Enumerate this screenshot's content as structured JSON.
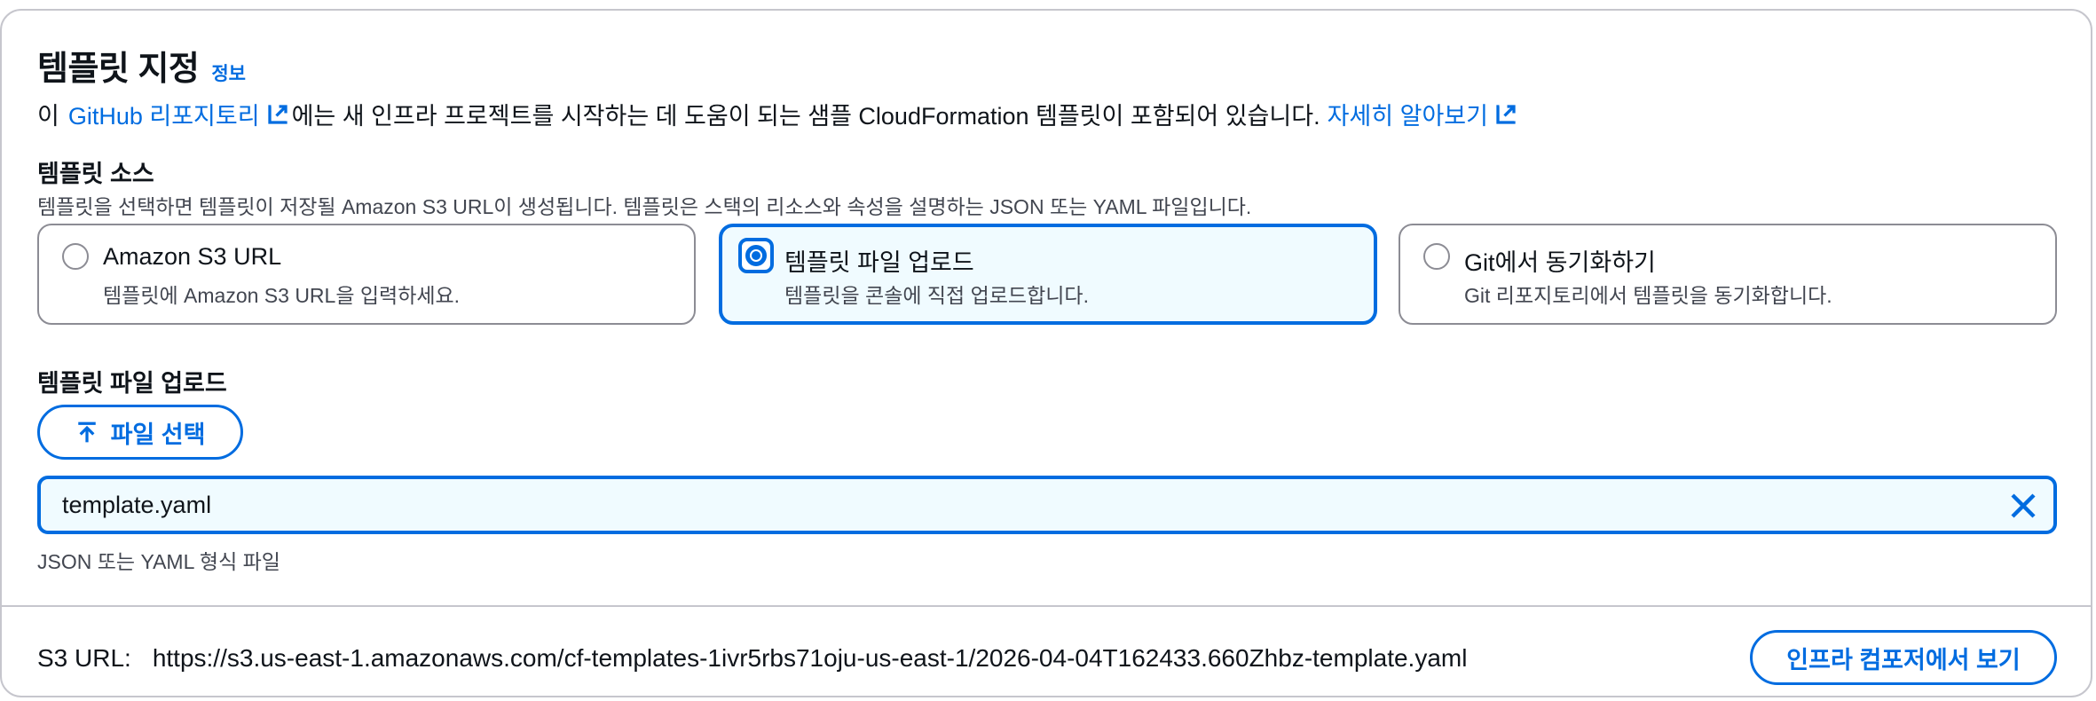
{
  "section": {
    "title": "템플릿 지정",
    "info_link": "정보",
    "description": {
      "prefix": "이",
      "repo_link": "GitHub 리포지토리",
      "middle": "에는 새 인프라 프로젝트를 시작하는 데 도움이 되는 샘플 CloudFormation 템플릿이 포함되어 있습니다.",
      "learn_more_link": "자세히 알아보기"
    }
  },
  "template_source": {
    "label": "템플릿 소스",
    "hint": "템플릿을 선택하면 템플릿이 저장될 Amazon S3 URL이 생성됩니다. 템플릿은 스택의 리소스와 속성을 설명하는 JSON 또는 YAML 파일입니다.",
    "options": [
      {
        "title": "Amazon S3 URL",
        "description": "템플릿에 Amazon S3 URL을 입력하세요.",
        "selected": false
      },
      {
        "title": "템플릿 파일 업로드",
        "description": "템플릿을 콘솔에 직접 업로드합니다.",
        "selected": true
      },
      {
        "title": "Git에서 동기화하기",
        "description": "Git 리포지토리에서 템플릿을 동기화합니다.",
        "selected": false
      }
    ]
  },
  "upload": {
    "label": "템플릿 파일 업로드",
    "choose_button": "파일 선택",
    "file_name": "template.yaml",
    "constraint": "JSON 또는 YAML 형식 파일"
  },
  "footer": {
    "s3_label": "S3 URL:",
    "s3_url": "https://s3.us-east-1.amazonaws.com/cf-templates-1ivr5rbs71oju-us-east-1/2026-04-04T162433.660Zhbz-template.yaml",
    "composer_button": "인프라 컴포저에서 보기"
  },
  "icons": {
    "external": "external-link-icon",
    "upload": "upload-arrow-icon",
    "dismiss": "close-icon"
  },
  "colors": {
    "accent": "#006ce0",
    "selected_bg": "#f0fbff",
    "border": "#8c8c94",
    "secondary_text": "#424650"
  }
}
